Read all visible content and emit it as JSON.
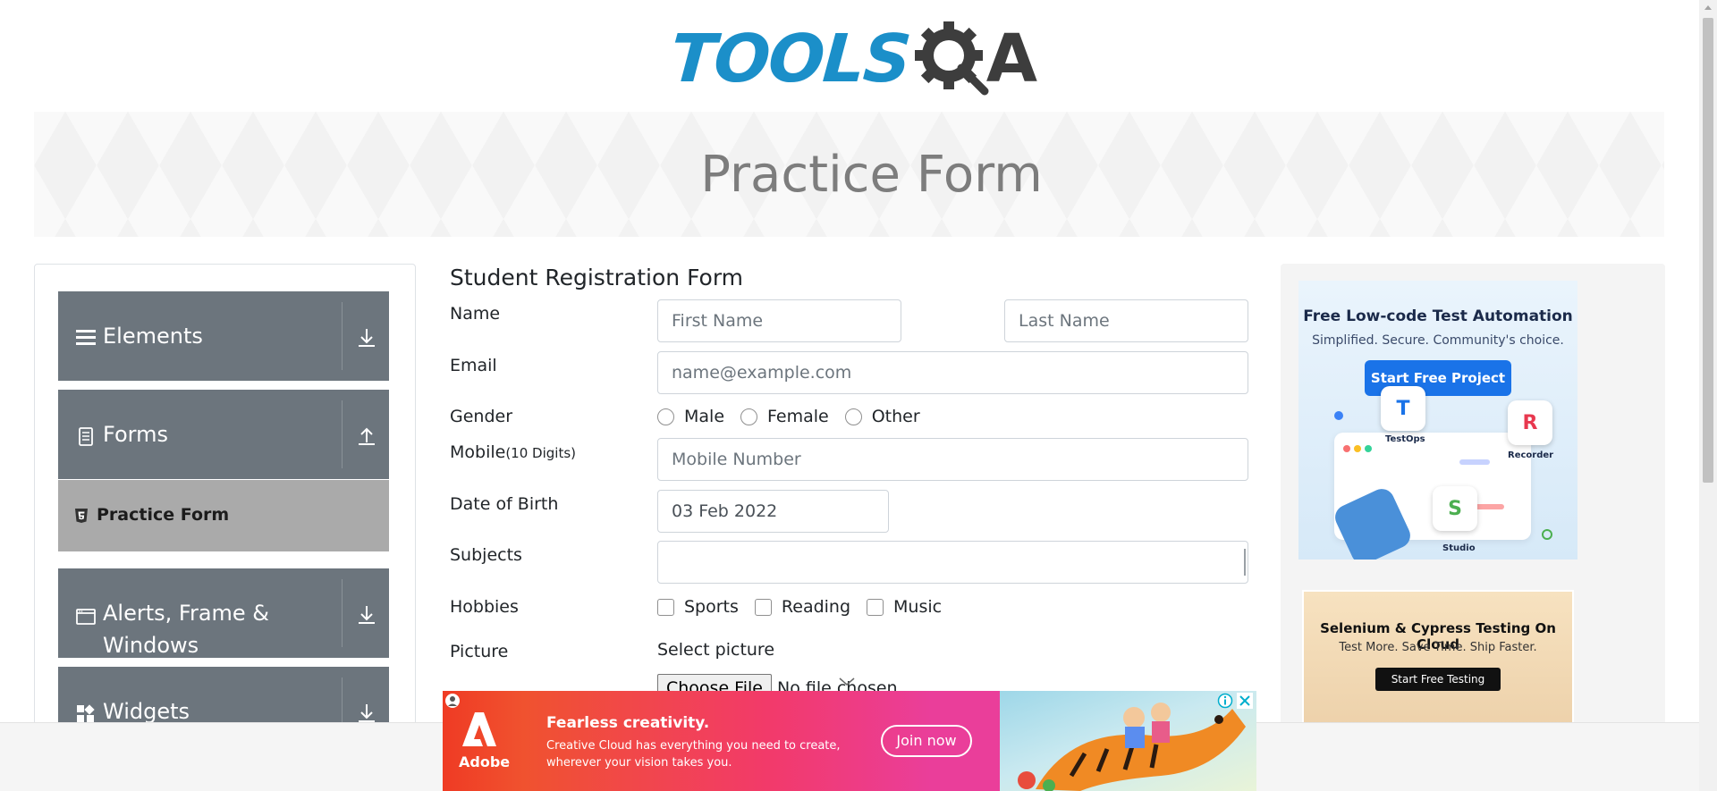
{
  "header": {
    "logo_text_left": "TOOLS",
    "logo_text_right": "A"
  },
  "banner": {
    "title": "Practice Form"
  },
  "sidebar": {
    "groups": [
      {
        "label": "Elements",
        "icon": "hamburger-icon",
        "arrow": "download-icon"
      },
      {
        "label": "Forms",
        "icon": "document-icon",
        "arrow": "upload-icon"
      },
      {
        "label": "Alerts, Frame & Windows",
        "icon": "window-icon",
        "arrow": "download-icon"
      },
      {
        "label": "Widgets",
        "icon": "widgets-icon",
        "arrow": "download-icon"
      }
    ],
    "active_item": {
      "label": "Practice Form",
      "icon": "html5-icon"
    }
  },
  "form": {
    "title": "Student Registration Form",
    "labels": {
      "name": "Name",
      "email": "Email",
      "gender": "Gender",
      "mobile": "Mobile",
      "mobile_hint": "(10 Digits)",
      "dob": "Date of Birth",
      "subjects": "Subjects",
      "hobbies": "Hobbies",
      "picture": "Picture"
    },
    "first_name": {
      "placeholder": "First Name",
      "value": ""
    },
    "last_name": {
      "placeholder": "Last Name",
      "value": ""
    },
    "email": {
      "placeholder": "name@example.com",
      "value": ""
    },
    "gender_options": [
      "Male",
      "Female",
      "Other"
    ],
    "mobile": {
      "placeholder": "Mobile Number",
      "value": ""
    },
    "dob": {
      "value": "03 Feb 2022"
    },
    "subjects": {
      "value": ""
    },
    "hobby_options": [
      "Sports",
      "Reading",
      "Music"
    ],
    "picture": {
      "select_label": "Select picture",
      "button_label": "Choose File",
      "status": "No file chosen"
    }
  },
  "ads": {
    "right_top": {
      "title": "Free Low-code Test Automation",
      "subtitle": "Simplified. Secure. Community's choice.",
      "cta": "Start Free Project",
      "chips": [
        {
          "letter": "T",
          "label": "TestOps",
          "color": "#1a73e8"
        },
        {
          "letter": "R",
          "label": "Recorder",
          "color": "#e8384f"
        },
        {
          "letter": "S",
          "label": "Studio",
          "color": "#4caf50"
        }
      ]
    },
    "right_bottom": {
      "title": "Selenium & Cypress Testing On Cloud",
      "subtitle": "Test More. Save Time. Ship Faster.",
      "cta": "Start Free Testing"
    },
    "bottom": {
      "brand": "Adobe",
      "headline": "Fearless creativity.",
      "body": "Creative Cloud has everything you need to create, wherever your vision takes you.",
      "cta": "Join now"
    }
  },
  "colors": {
    "sidebar_group": "#6c757d",
    "sidebar_active": "#aaaaaa",
    "logo_blue": "#1b8fc9",
    "logo_dark": "#3d3d3d"
  }
}
